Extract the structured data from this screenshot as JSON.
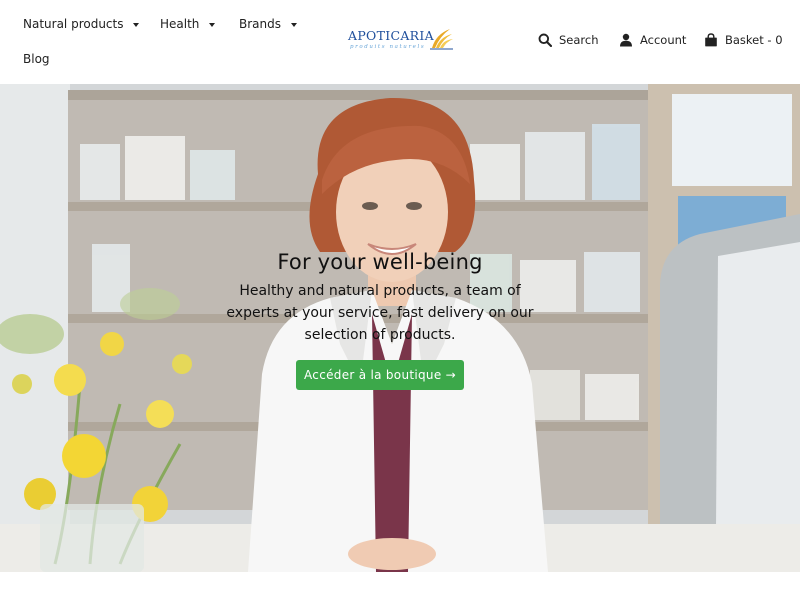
{
  "header": {
    "nav": {
      "natural_products": "Natural products",
      "health": "Health",
      "brands": "Brands",
      "blog": "Blog"
    },
    "logo": {
      "name": "APOTICARIA",
      "tagline": "produits naturels"
    },
    "utility": {
      "search": "Search",
      "account": "Account",
      "basket": "Basket - 0"
    }
  },
  "hero": {
    "title": "For your well-being",
    "subtitle": "Healthy and natural products, a team of experts at your service, fast delivery on our selection of products.",
    "cta": "Accéder à la boutique →"
  },
  "colors": {
    "accent_green": "#3ca84a",
    "logo_blue": "#1f4f9c",
    "logo_sun": "#e9a928"
  },
  "icons": {
    "search": "search-icon",
    "account": "user-icon",
    "basket": "bag-icon",
    "dropdown": "caret-down-icon"
  }
}
